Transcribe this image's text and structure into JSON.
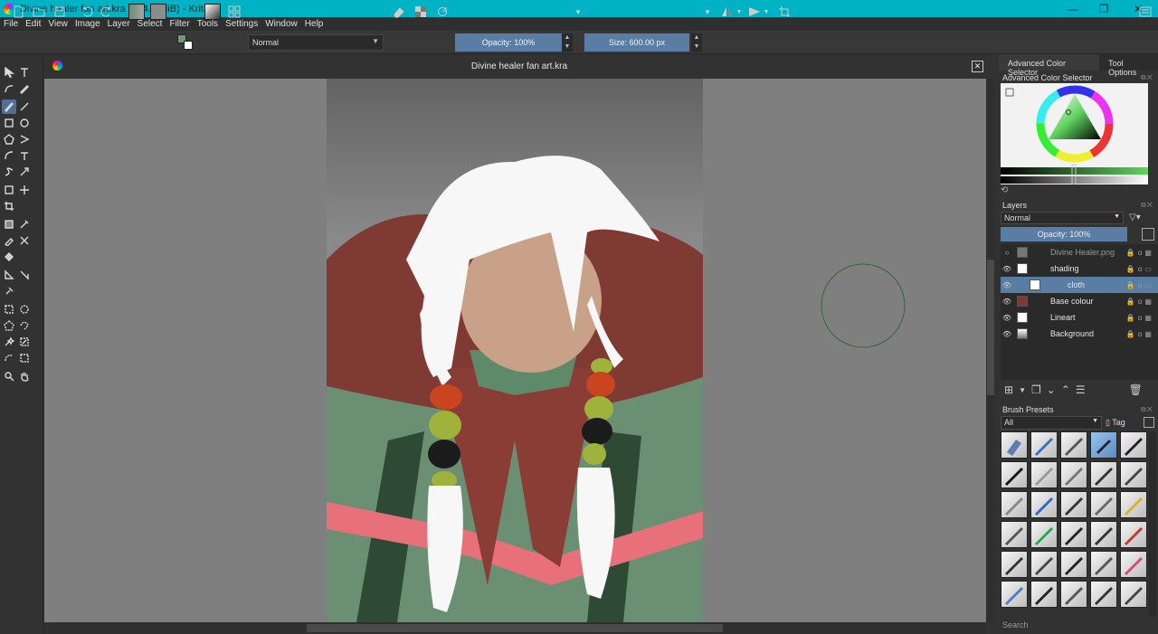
{
  "window": {
    "title": "Divine healer fan art.kra (364.5 MiB)  - Krita",
    "minimize": "—",
    "maximize": "❐",
    "close": "✕"
  },
  "menu": [
    "File",
    "Edit",
    "View",
    "Image",
    "Layer",
    "Select",
    "Filter",
    "Tools",
    "Settings",
    "Window",
    "Help"
  ],
  "toolbar": {
    "blend_mode": "Normal",
    "opacity": "Opacity: 100%",
    "size": "Size: 600.00 px",
    "fg_color": "#6e9a78",
    "bg_color": "#8c8c8c"
  },
  "document": {
    "title": "Divine healer fan art.kra"
  },
  "dock": {
    "tabs": [
      "Advanced Color Selector",
      "Tool Options"
    ],
    "color_panel_title": "Advanced Color Selector",
    "layers_title": "Layers",
    "layers_blend": "Normal",
    "layers_opacity": "Opacity:  100%",
    "layers": [
      {
        "name": "Divine Healer.png",
        "visible": false,
        "selected": false
      },
      {
        "name": "shading",
        "visible": true,
        "selected": false
      },
      {
        "name": "cloth",
        "visible": true,
        "selected": true
      },
      {
        "name": "Base colour",
        "visible": true,
        "selected": false
      },
      {
        "name": "Lineart",
        "visible": true,
        "selected": false
      },
      {
        "name": "Background",
        "visible": true,
        "selected": false
      }
    ],
    "presets_title": "Brush Presets",
    "presets_filter": "All",
    "presets_tag": "Tag",
    "search_placeholder": "Search"
  },
  "colors": {
    "accent": "#5a7da3",
    "titlebar": "#00b3c4"
  }
}
